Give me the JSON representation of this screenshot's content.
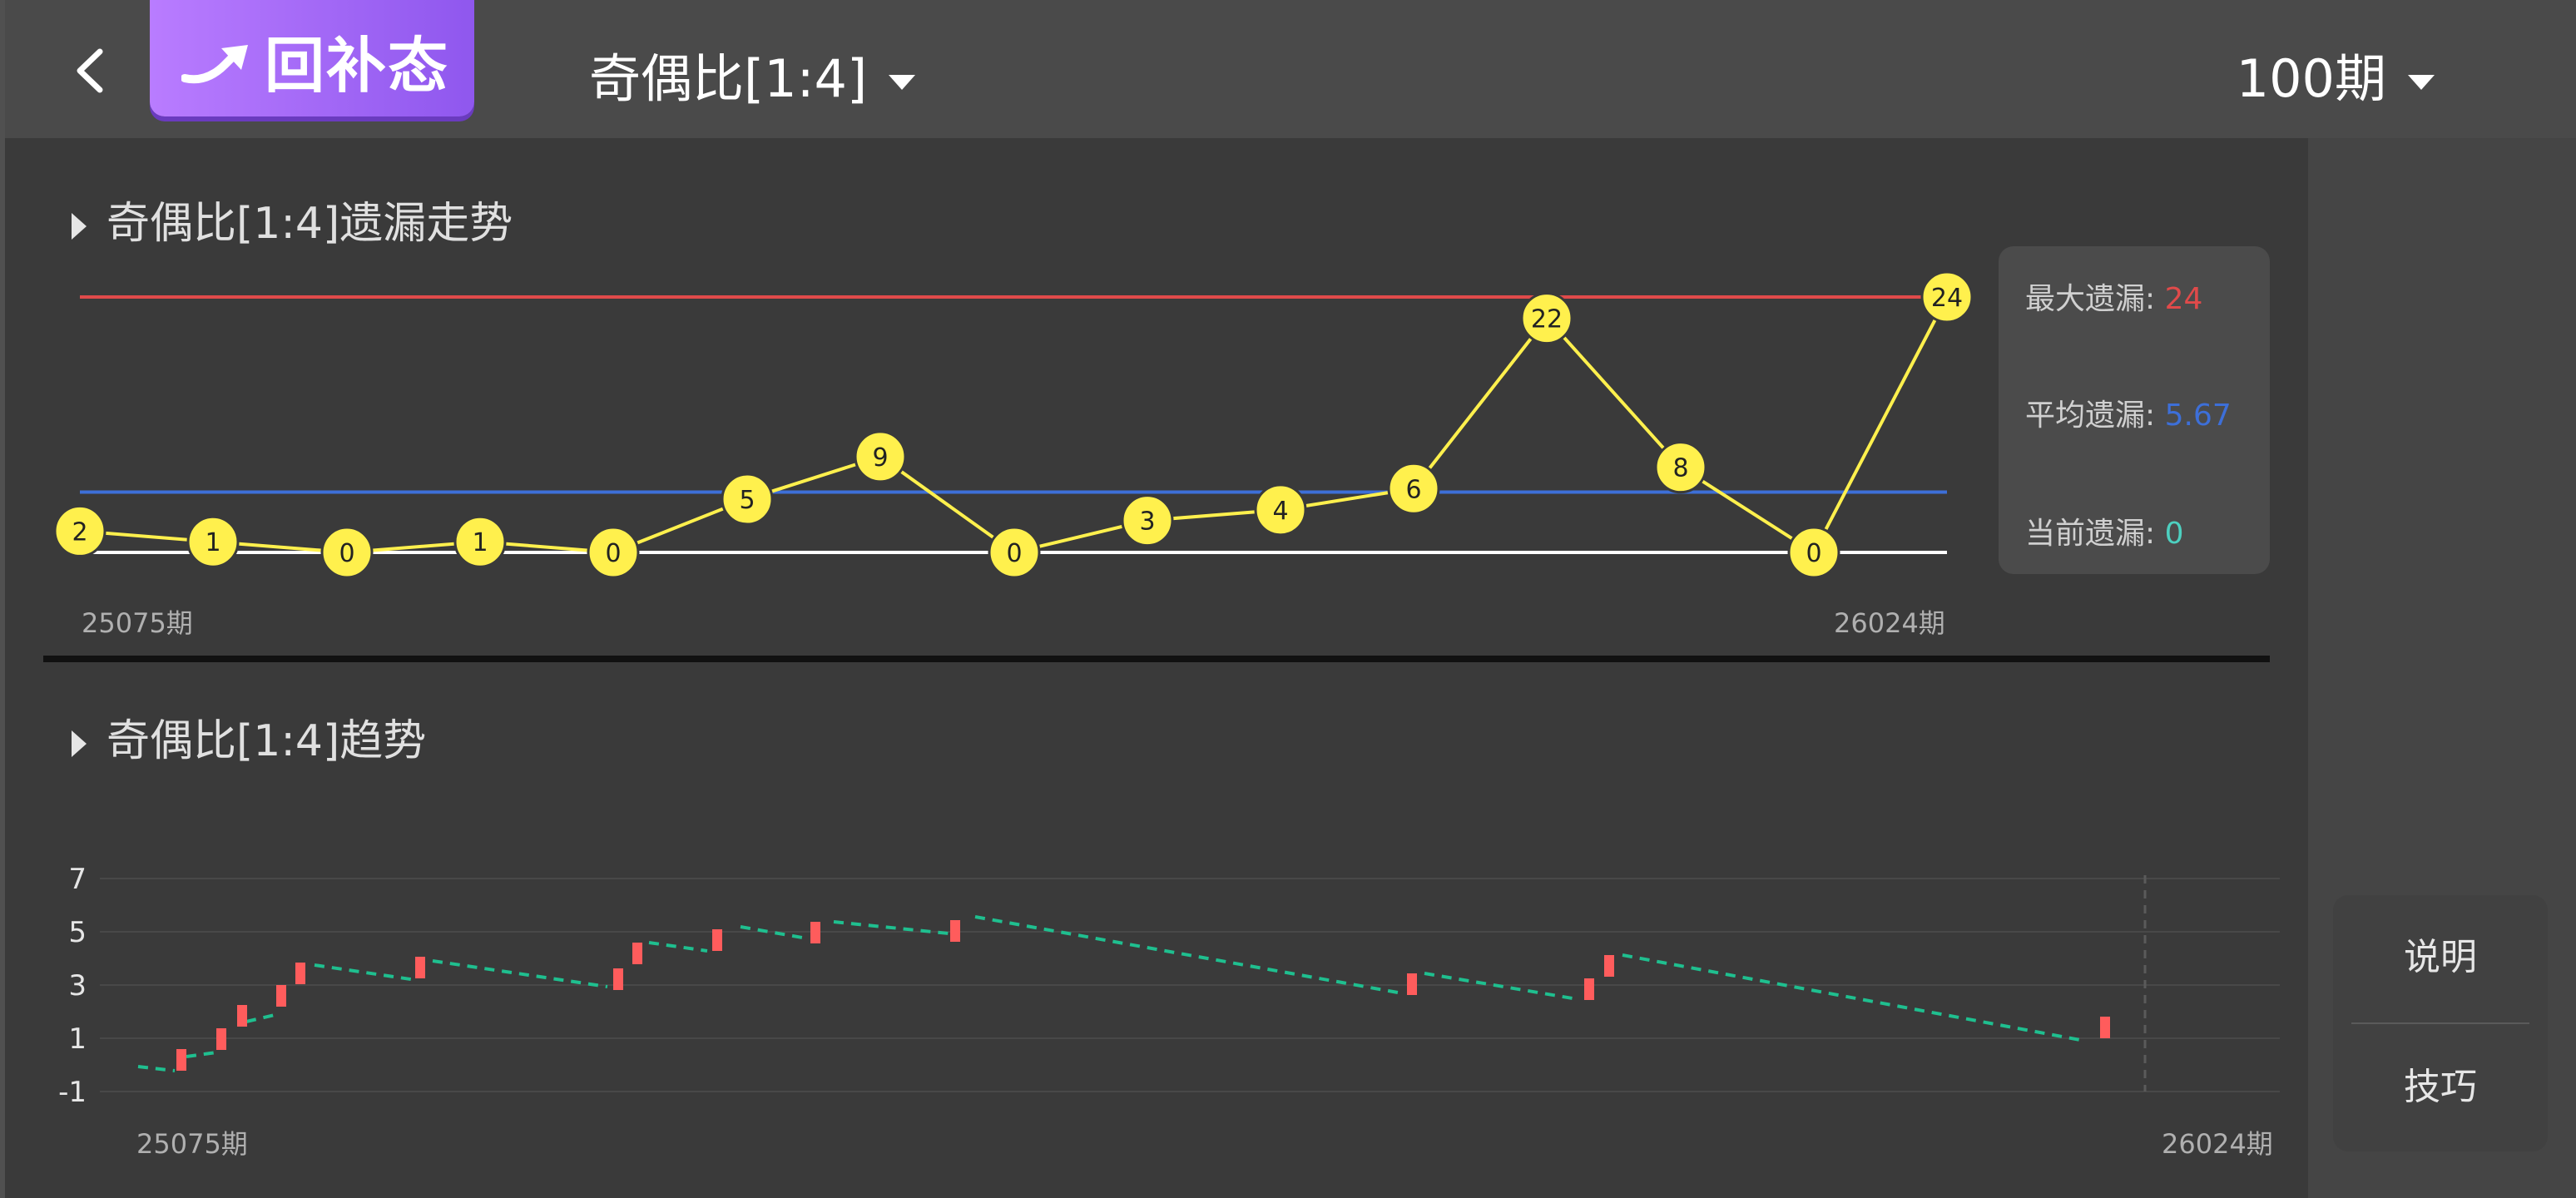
{
  "header": {
    "state_button_label": "回补态",
    "title_dropdown": "奇偶比[1:4]",
    "period_dropdown": "100期"
  },
  "omission": {
    "section_title": "奇偶比[1:4]遗漏走势",
    "start_label": "25075期",
    "end_label": "26024期",
    "stats": {
      "max_label": "最大遗漏:",
      "max_value": "24",
      "avg_label": "平均遗漏:",
      "avg_value": "5.67",
      "current_label": "当前遗漏:",
      "current_value": "0"
    }
  },
  "trend": {
    "section_title": "奇偶比[1:4]趋势",
    "start_label": "25075期",
    "end_label": "26024期"
  },
  "side_buttons": {
    "explain": "说明",
    "tips": "技巧"
  },
  "colors": {
    "max_line": "#e04a4a",
    "avg_line": "#3d6fd8",
    "zero_line": "#ffffff",
    "point_fill": "#fff04d",
    "current_value": "#4dd0c0",
    "candle": "#ff5c5c",
    "dash": "#1fbf8f"
  },
  "chart_data": [
    {
      "type": "line",
      "title": "奇偶比[1:4]遗漏走势",
      "x": [
        "25075期",
        "",
        "",
        "",
        "",
        "",
        "",
        "",
        "",
        "",
        "",
        "",
        "",
        "",
        "26024期"
      ],
      "series": [
        {
          "values": [
            2,
            1,
            0,
            1,
            0,
            5,
            9,
            0,
            3,
            4,
            6,
            22,
            8,
            0,
            24
          ]
        }
      ],
      "reference_lines": {
        "max": 24,
        "average": 5.67,
        "zero": 0
      },
      "ylim": [
        0,
        24
      ]
    },
    {
      "type": "line",
      "title": "奇偶比[1:4]趋势",
      "x_start": "25075期",
      "x_end": "26024期",
      "y_ticks": [
        7,
        5,
        3,
        1,
        -1
      ],
      "ylim": [
        -1,
        7
      ]
    }
  ]
}
